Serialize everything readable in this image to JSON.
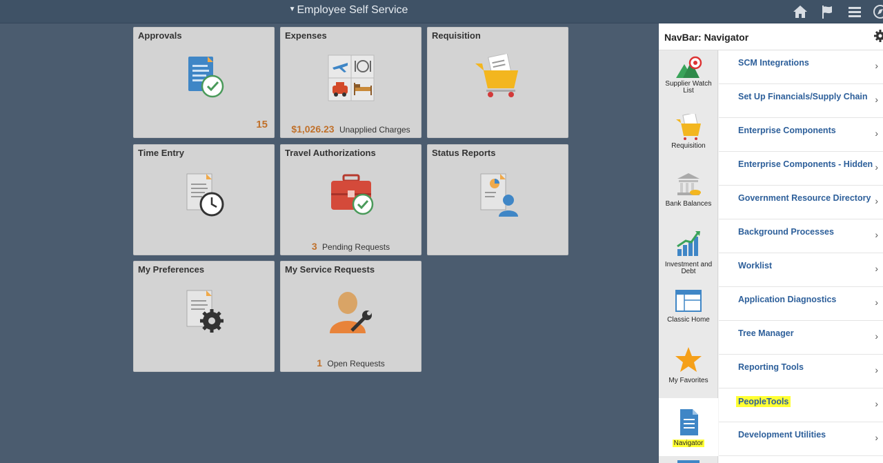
{
  "header": {
    "title": "Employee Self Service",
    "icons": [
      "home-icon",
      "flag-icon",
      "menu-icon",
      "navbar-icon"
    ]
  },
  "tiles": [
    {
      "title": "Approvals",
      "icon": "document-check-icon",
      "count": "15"
    },
    {
      "title": "Expenses",
      "icon": "expenses-icon",
      "amount": "$1,026.23",
      "amount_label": "Unapplied Charges"
    },
    {
      "title": "Requisition",
      "icon": "cart-icon"
    },
    {
      "title": "Time Entry",
      "icon": "clock-document-icon"
    },
    {
      "title": "Travel Authorizations",
      "icon": "briefcase-check-icon",
      "count": "3",
      "count_label": "Pending Requests"
    },
    {
      "title": "Status Reports",
      "icon": "report-person-icon"
    },
    {
      "title": "My Preferences",
      "icon": "document-gear-icon"
    },
    {
      "title": "My Service Requests",
      "icon": "person-wrench-icon",
      "count": "1",
      "count_label": "Open Requests"
    }
  ],
  "navbar": {
    "title": "NavBar: Navigator",
    "side_items": [
      {
        "label": "Supplier Watch List"
      },
      {
        "label": "Requisition"
      },
      {
        "label": "Bank Balances"
      },
      {
        "label": "Investment and Debt"
      },
      {
        "label": "Classic Home"
      },
      {
        "label": "My Favorites"
      },
      {
        "label": "Navigator"
      }
    ],
    "menu_items": [
      {
        "label": "SCM Integrations"
      },
      {
        "label": "Set Up Financials/Supply Chain"
      },
      {
        "label": "Enterprise Components"
      },
      {
        "label": "Enterprise Components - Hidden"
      },
      {
        "label": "Government Resource Directory"
      },
      {
        "label": "Background Processes"
      },
      {
        "label": "Worklist"
      },
      {
        "label": "Application Diagnostics"
      },
      {
        "label": "Tree Manager"
      },
      {
        "label": "Reporting Tools"
      },
      {
        "label": "PeopleTools"
      },
      {
        "label": "Development Utilities"
      }
    ]
  },
  "colors": {
    "accent": "#c0702a",
    "link": "#2d5f9a",
    "highlight": "#ffff33",
    "background": "#4b5c6f"
  }
}
